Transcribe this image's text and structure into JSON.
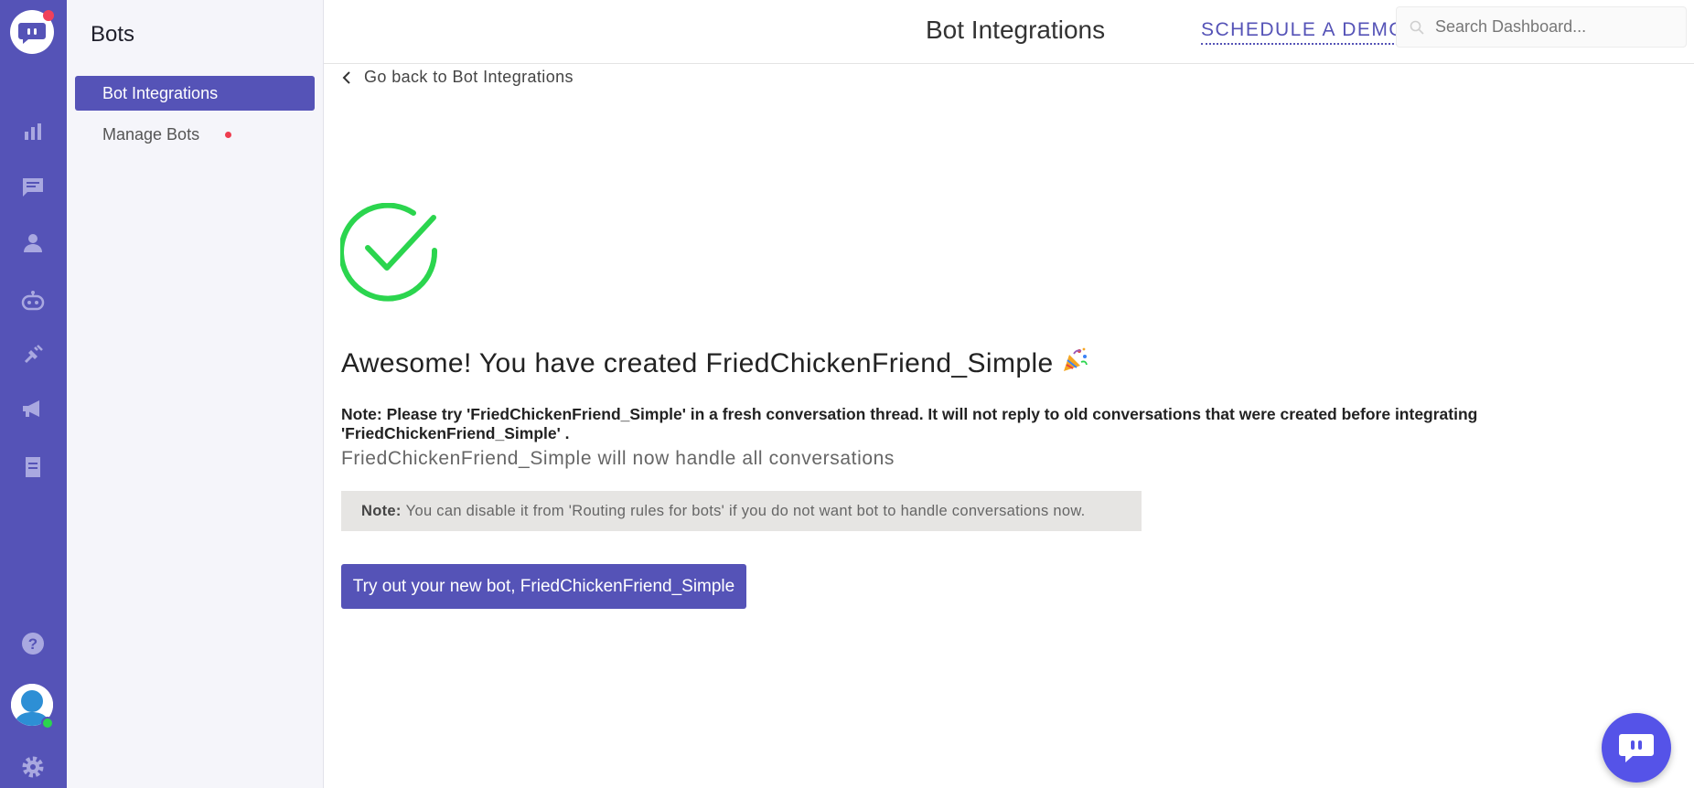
{
  "sidebar": {
    "title": "Bots",
    "items": [
      {
        "label": "Bot Integrations"
      },
      {
        "label": "Manage Bots"
      }
    ]
  },
  "header": {
    "title": "Bot Integrations",
    "demo_link": "SCHEDULE A DEMO",
    "search_placeholder": "Search Dashboard..."
  },
  "main": {
    "back_link": "Go back to Bot Integrations",
    "headline": "Awesome! You have created FriedChickenFriend_Simple",
    "headline_emoji": "🎉",
    "note": "Note: Please try 'FriedChickenFriend_Simple' in a fresh conversation thread. It will not reply to old conversations that were created before integrating 'FriedChickenFriend_Simple' .",
    "handle_text": "FriedChickenFriend_Simple will now handle all conversations",
    "notebox_label": "Note:",
    "notebox_text": "You can disable it from 'Routing rules for bots' if you do not want bot to handle conversations now.",
    "try_button": "Try out your new bot, FriedChickenFriend_Simple"
  },
  "colors": {
    "brand": "#5553b7",
    "success": "#2bd54e",
    "notification": "#f0405a"
  },
  "icons": [
    "app-logo-icon",
    "analytics-icon",
    "conversations-icon",
    "users-icon",
    "bot-icon",
    "integrations-icon",
    "campaigns-icon",
    "reports-icon",
    "help-icon",
    "settings-icon",
    "chevron-left-icon",
    "success-check-icon",
    "party-popper-icon",
    "search-icon",
    "chat-widget-icon"
  ]
}
